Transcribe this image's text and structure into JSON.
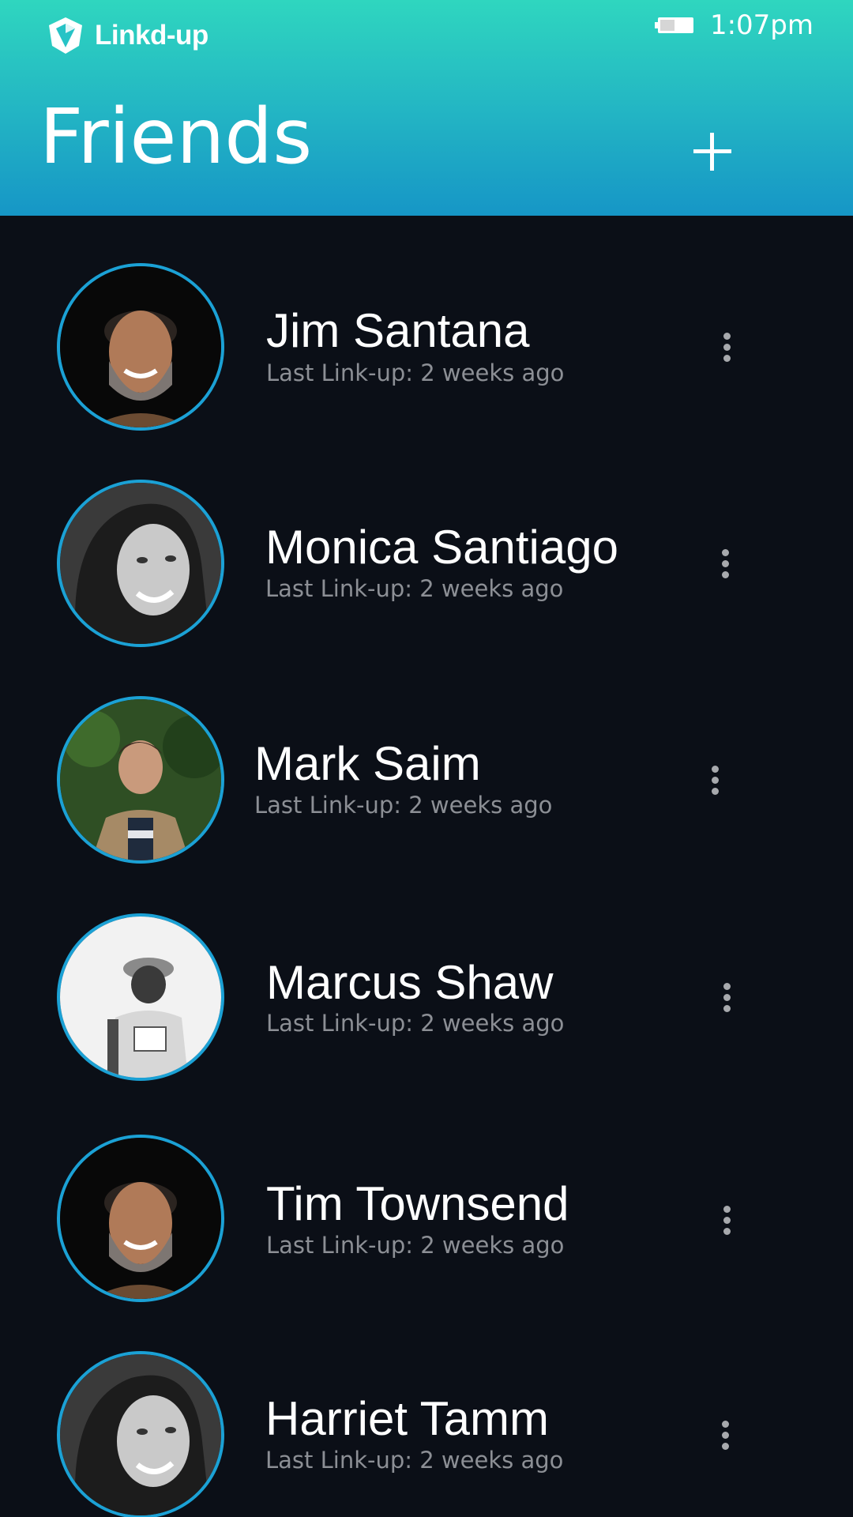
{
  "app": {
    "brand_name": "Linkd-up",
    "time": "1:07pm",
    "page_title": "Friends",
    "accent_color": "#1ba1d5",
    "header_gradient": [
      "#2fd6bf",
      "#1696c6"
    ],
    "background_color": "#0b0f17"
  },
  "icons": {
    "logo": "linkdup-logo-icon",
    "battery": "battery-icon",
    "add": "plus-icon",
    "more": "more-vertical-icon"
  },
  "friends": [
    {
      "name": "Jim Santana",
      "last_linkup": "Last Link-up: 2 weeks ago"
    },
    {
      "name": "Monica Santiago",
      "last_linkup": "Last Link-up: 2 weeks ago"
    },
    {
      "name": "Mark Saim",
      "last_linkup": "Last Link-up: 2 weeks ago"
    },
    {
      "name": "Marcus Shaw",
      "last_linkup": "Last Link-up: 2 weeks ago"
    },
    {
      "name": "Tim Townsend",
      "last_linkup": "Last Link-up: 2 weeks ago"
    },
    {
      "name": "Harriet Tamm",
      "last_linkup": "Last Link-up: 2 weeks ago"
    }
  ]
}
